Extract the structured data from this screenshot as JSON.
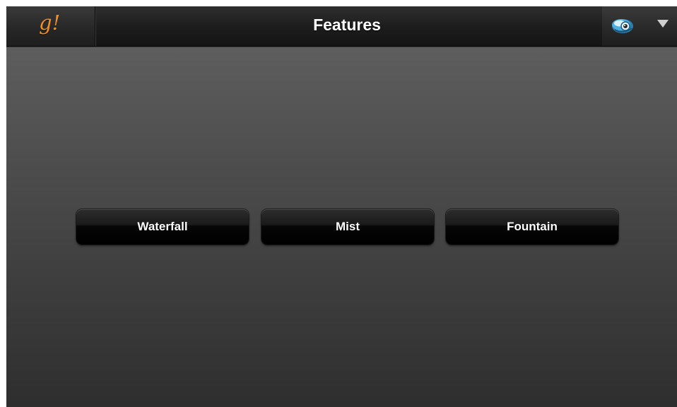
{
  "header": {
    "logo_text": "g!",
    "title": "Features",
    "status_icon": "device-status-icon",
    "menu_icon": "chevron-down-icon"
  },
  "features": {
    "buttons": [
      {
        "label": "Waterfall"
      },
      {
        "label": "Mist"
      },
      {
        "label": "Fountain"
      }
    ]
  },
  "colors": {
    "logo": "#ef8f1f",
    "background_top": "#636363",
    "background_bottom": "#2e2e2e",
    "topbar": "#1c1c1c",
    "button": "#0a0a0a",
    "text": "#ffffff"
  }
}
